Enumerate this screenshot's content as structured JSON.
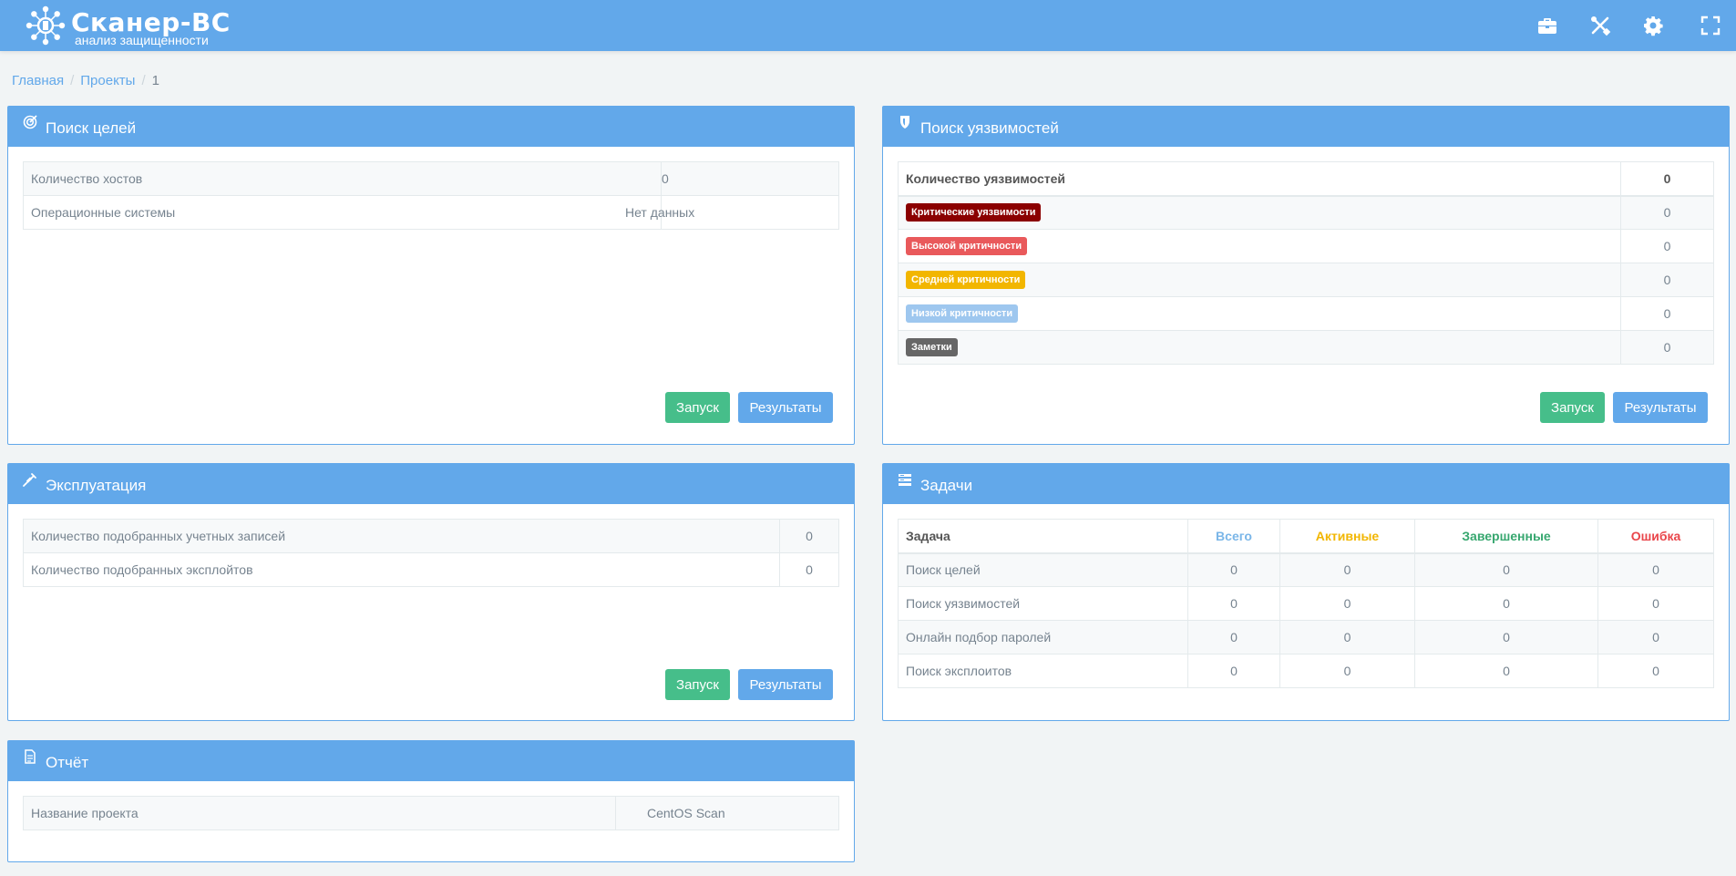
{
  "header": {
    "logo_title": "Сканер-ВС",
    "logo_subtitle": "анализ защищенности",
    "icons": [
      "briefcase-icon",
      "tools-icon",
      "settings-gear-icon",
      "fullscreen-icon"
    ]
  },
  "breadcrumb": {
    "home": "Главная",
    "projects": "Проекты",
    "current": "1"
  },
  "target_search": {
    "title": "Поиск целей",
    "rows": [
      {
        "label": "Количество хостов",
        "value": "0"
      },
      {
        "label": "Операционные системы",
        "value": "Нет данных"
      }
    ],
    "start_label": "Запуск",
    "results_label": "Результаты"
  },
  "vuln_search": {
    "title": "Поиск уязвимостей",
    "header_label": "Количество уязвимостей",
    "header_value": "0",
    "rows": [
      {
        "label": "Критические уязвимости",
        "value": "0",
        "color": "#8b0000"
      },
      {
        "label": "Высокой критичности",
        "value": "0",
        "color": "#e9595b"
      },
      {
        "label": "Средней критичности",
        "value": "0",
        "color": "#f2b600"
      },
      {
        "label": "Низкой критичности",
        "value": "0",
        "color": "#9ec7ef"
      },
      {
        "label": "Заметки",
        "value": "0",
        "color": "#666666"
      }
    ],
    "start_label": "Запуск",
    "results_label": "Результаты"
  },
  "exploitation": {
    "title": "Эксплуатация",
    "rows": [
      {
        "label": "Количество подобранных учетных записей",
        "value": "0"
      },
      {
        "label": "Количество подобранных эксплойтов",
        "value": "0"
      }
    ],
    "start_label": "Запуск",
    "results_label": "Результаты"
  },
  "tasks": {
    "title": "Задачи",
    "columns": [
      {
        "label": "Задача",
        "color": "#555555"
      },
      {
        "label": "Всего",
        "color": "#7ab6e8"
      },
      {
        "label": "Активные",
        "color": "#f2b600"
      },
      {
        "label": "Завершенные",
        "color": "#37a76f"
      },
      {
        "label": "Ошибка",
        "color": "#e9454a"
      }
    ],
    "rows": [
      {
        "name": "Поиск целей",
        "total": "0",
        "active": "0",
        "done": "0",
        "error": "0"
      },
      {
        "name": "Поиск уязвимостей",
        "total": "0",
        "active": "0",
        "done": "0",
        "error": "0"
      },
      {
        "name": "Онлайн подбор паролей",
        "total": "0",
        "active": "0",
        "done": "0",
        "error": "0"
      },
      {
        "name": "Поиск эксплоитов",
        "total": "0",
        "active": "0",
        "done": "0",
        "error": "0"
      }
    ]
  },
  "report": {
    "title": "Отчёт",
    "rows": [
      {
        "label": "Название проекта",
        "value": "CentOS Scan"
      }
    ]
  }
}
